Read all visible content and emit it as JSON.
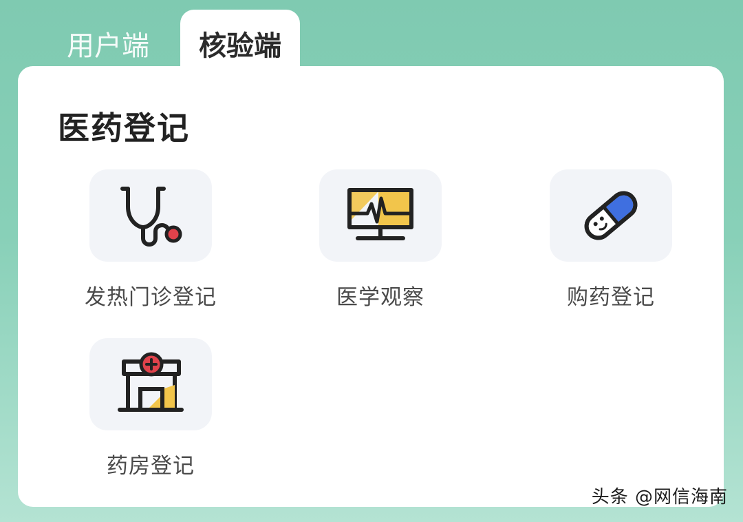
{
  "tabs": [
    {
      "label": "用户端",
      "active": false
    },
    {
      "label": "核验端",
      "active": true
    }
  ],
  "section": {
    "title": "医药登记"
  },
  "items": [
    {
      "label": "发热门诊登记",
      "icon": "stethoscope-icon"
    },
    {
      "label": "医学观察",
      "icon": "monitor-icon"
    },
    {
      "label": "购药登记",
      "icon": "pill-icon"
    },
    {
      "label": "药房登记",
      "icon": "pharmacy-icon"
    }
  ],
  "watermark": "头条 @网信海南",
  "colors": {
    "background": "#86cfb6",
    "panel": "#ffffff",
    "icon_bg": "#f2f4f8",
    "accent_red": "#e0424b",
    "accent_yellow": "#f2c54b",
    "accent_blue": "#3f6fe0",
    "icon_stroke": "#222222"
  }
}
